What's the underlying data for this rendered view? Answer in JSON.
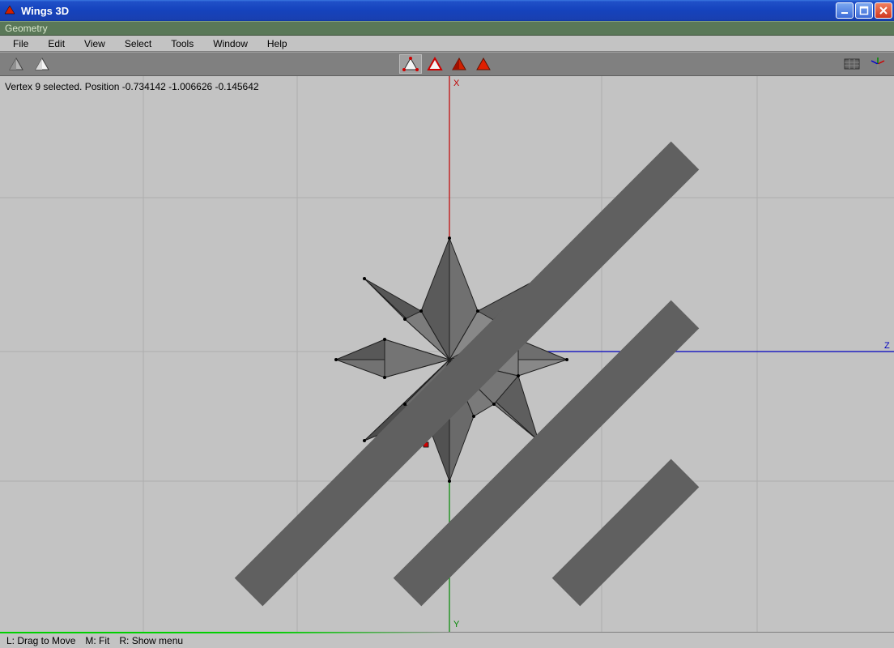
{
  "window": {
    "title": "Wings 3D"
  },
  "geometry_label": "Geometry",
  "menu": {
    "file": "File",
    "edit": "Edit",
    "view": "View",
    "select": "Select",
    "tools": "Tools",
    "window": "Window",
    "help": "Help"
  },
  "selection_info": "Vertex 9 selected. Position -0.734142 -1.006626 -0.145642",
  "axes": {
    "x": "X",
    "y": "Y",
    "z": "Z"
  },
  "status": {
    "left_mouse": "L: Drag to Move",
    "mid_mouse": "M: Fit",
    "right_mouse": "R: Show menu"
  },
  "icons": {
    "undo": "undo-icon",
    "redo": "redo-icon",
    "mode_vertex": "vertex-mode-icon",
    "mode_edge": "edge-mode-icon",
    "mode_face": "face-mode-icon",
    "mode_body": "body-mode-icon",
    "ground": "ground-plane-icon",
    "axis_toggle": "axes-toggle-icon"
  },
  "colors": {
    "titlebar": "#1a4ac0",
    "geometry_bar": "#5a7858",
    "toolbar": "#808080",
    "viewport_bg": "#c3c3c3",
    "axis_x": "#c00000",
    "axis_y": "#008800",
    "axis_z": "#0000c0",
    "model_fill_dark": "#555555",
    "model_fill_mid": "#6b6b6b",
    "model_fill_light": "#848484"
  }
}
